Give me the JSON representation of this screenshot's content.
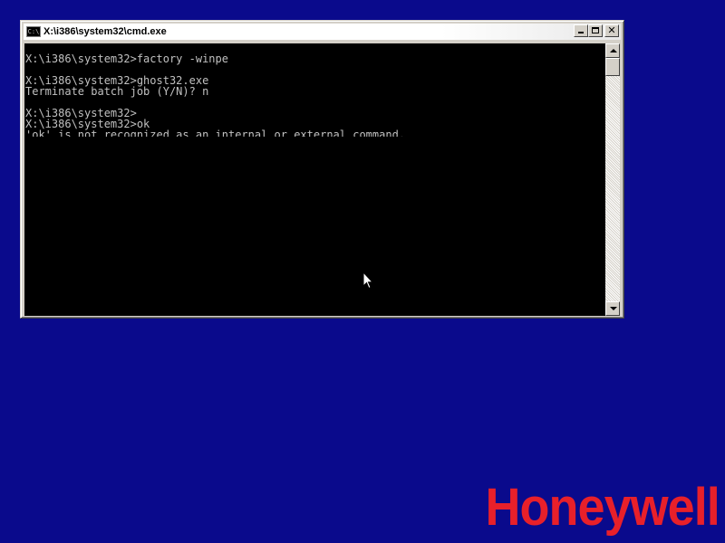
{
  "window": {
    "title": "X:\\i386\\system32\\cmd.exe",
    "icon_label": "C:\\",
    "buttons": {
      "minimize": "minimize-icon",
      "maximize": "maximize-icon",
      "close": "close-icon"
    }
  },
  "console": {
    "lines": [
      "X:\\i386\\system32>factory -winpe",
      "",
      "X:\\i386\\system32>ghost32.exe",
      "Terminate batch job (Y/N)? n",
      "",
      "X:\\i386\\system32>",
      "X:\\i386\\system32>ok",
      "'ok' is not recognized as an internal or external command,"
    ],
    "text_color": "#c0c0c0",
    "background_color": "#000000"
  },
  "desktop": {
    "background_color": "#0a0a8c",
    "logo_text": "Honeywell",
    "logo_color": "#e8202a"
  }
}
